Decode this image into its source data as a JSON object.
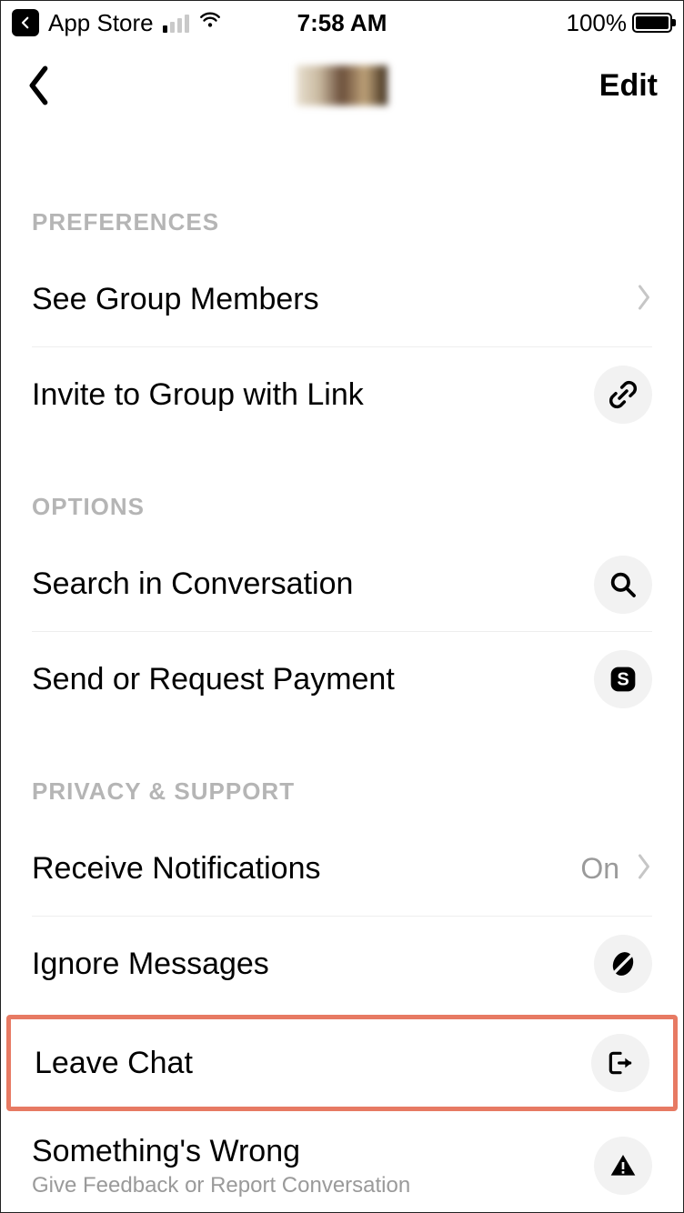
{
  "statusbar": {
    "app_return": "App Store",
    "time": "7:58 AM",
    "battery_pct": "100%"
  },
  "nav": {
    "edit": "Edit"
  },
  "sections": {
    "preferences": {
      "header": "PREFERENCES",
      "group_members": "See Group Members",
      "invite_link": "Invite to Group with Link"
    },
    "options": {
      "header": "OPTIONS",
      "search": "Search in Conversation",
      "payment": "Send or Request Payment"
    },
    "privacy": {
      "header": "PRIVACY & SUPPORT",
      "notifications": "Receive Notifications",
      "notifications_value": "On",
      "ignore": "Ignore Messages",
      "leave": "Leave Chat",
      "wrong": "Something's Wrong",
      "wrong_sub": "Give Feedback or Report Conversation"
    }
  }
}
